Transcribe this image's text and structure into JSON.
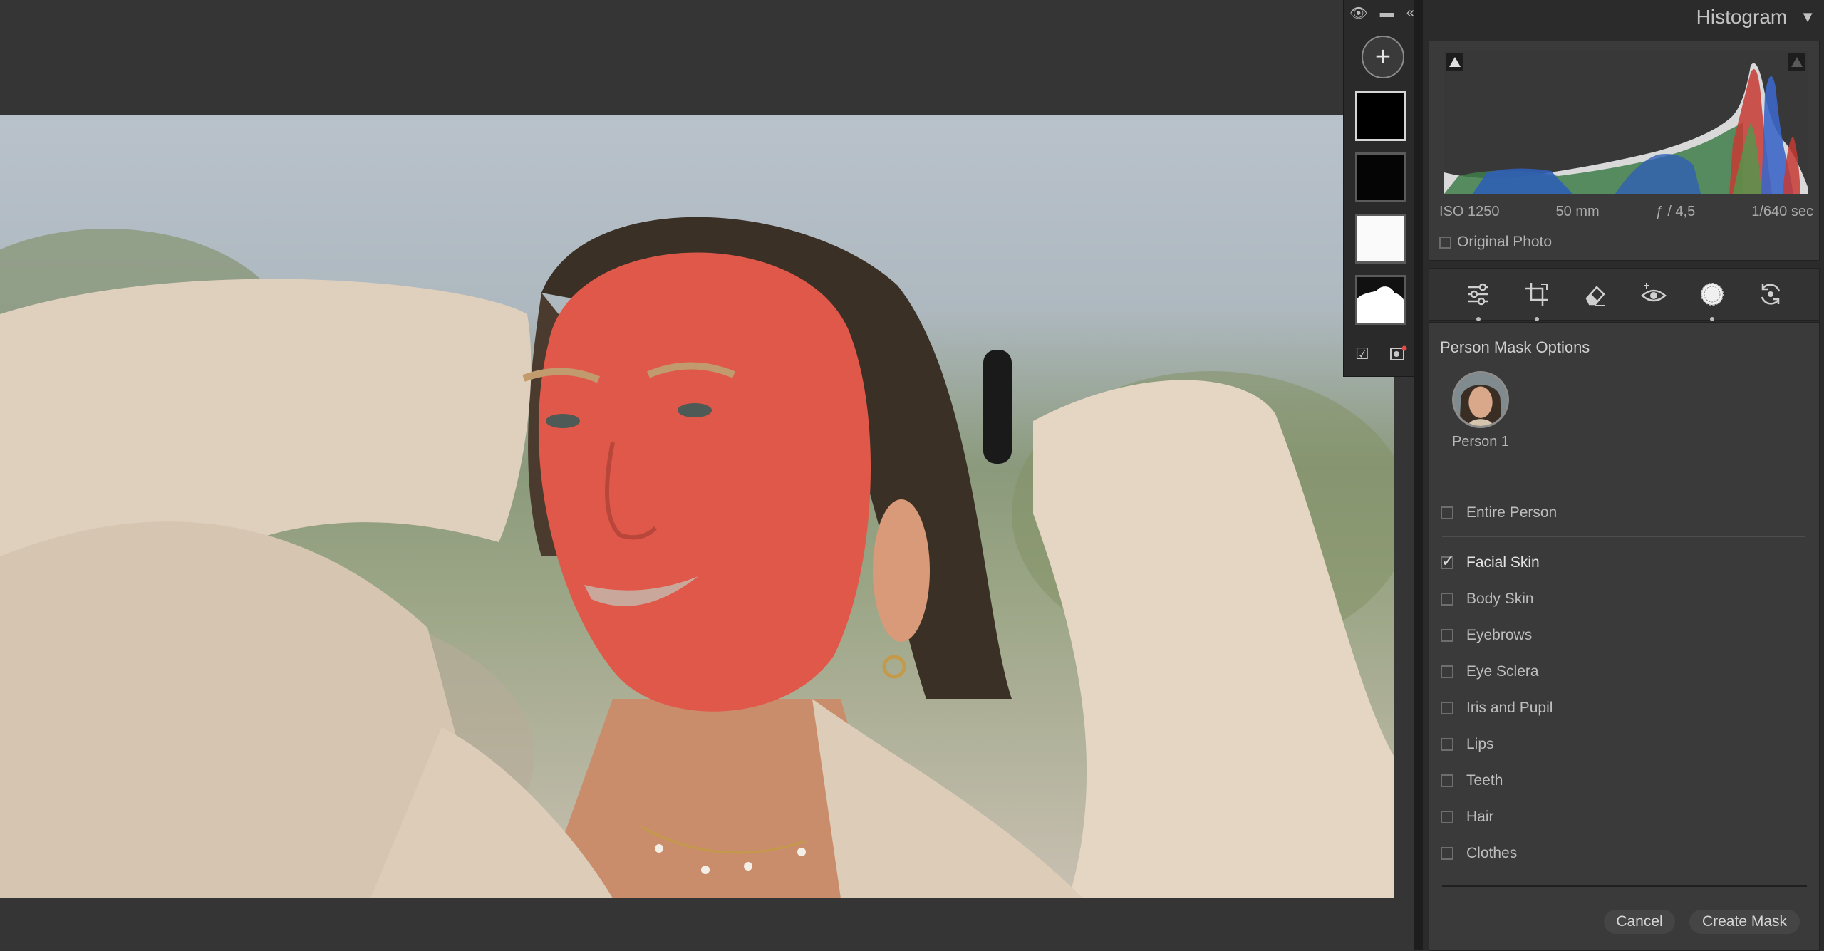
{
  "histogram": {
    "title": "Histogram",
    "exif": {
      "iso": "ISO 1250",
      "focal": "50 mm",
      "aperture": "ƒ / 4,5",
      "shutter": "1/640 sec"
    },
    "original_photo_label": "Original Photo"
  },
  "tools": [
    {
      "name": "edit-sliders-icon",
      "dot": true
    },
    {
      "name": "crop-icon",
      "dot": true
    },
    {
      "name": "healing-eraser-icon",
      "dot": false
    },
    {
      "name": "red-eye-icon",
      "dot": false
    },
    {
      "name": "masking-icon",
      "dot": true,
      "active": true
    },
    {
      "name": "presets-icon",
      "dot": false
    }
  ],
  "mask_options": {
    "title": "Person Mask Options",
    "person_label": "Person 1",
    "items": [
      {
        "label": "Entire Person",
        "checked": false
      },
      {
        "label": "Facial Skin",
        "checked": true
      },
      {
        "label": "Body Skin",
        "checked": false
      },
      {
        "label": "Eyebrows",
        "checked": false
      },
      {
        "label": "Eye Sclera",
        "checked": false
      },
      {
        "label": "Iris and Pupil",
        "checked": false
      },
      {
        "label": "Lips",
        "checked": false
      },
      {
        "label": "Teeth",
        "checked": false
      },
      {
        "label": "Hair",
        "checked": false
      },
      {
        "label": "Clothes",
        "checked": false
      }
    ],
    "cancel_label": "Cancel",
    "create_label": "Create Mask"
  },
  "colors": {
    "mask_overlay": "#e0584a",
    "panel_bg": "#3a3a3a",
    "accent_text": "#d6d6d6"
  }
}
